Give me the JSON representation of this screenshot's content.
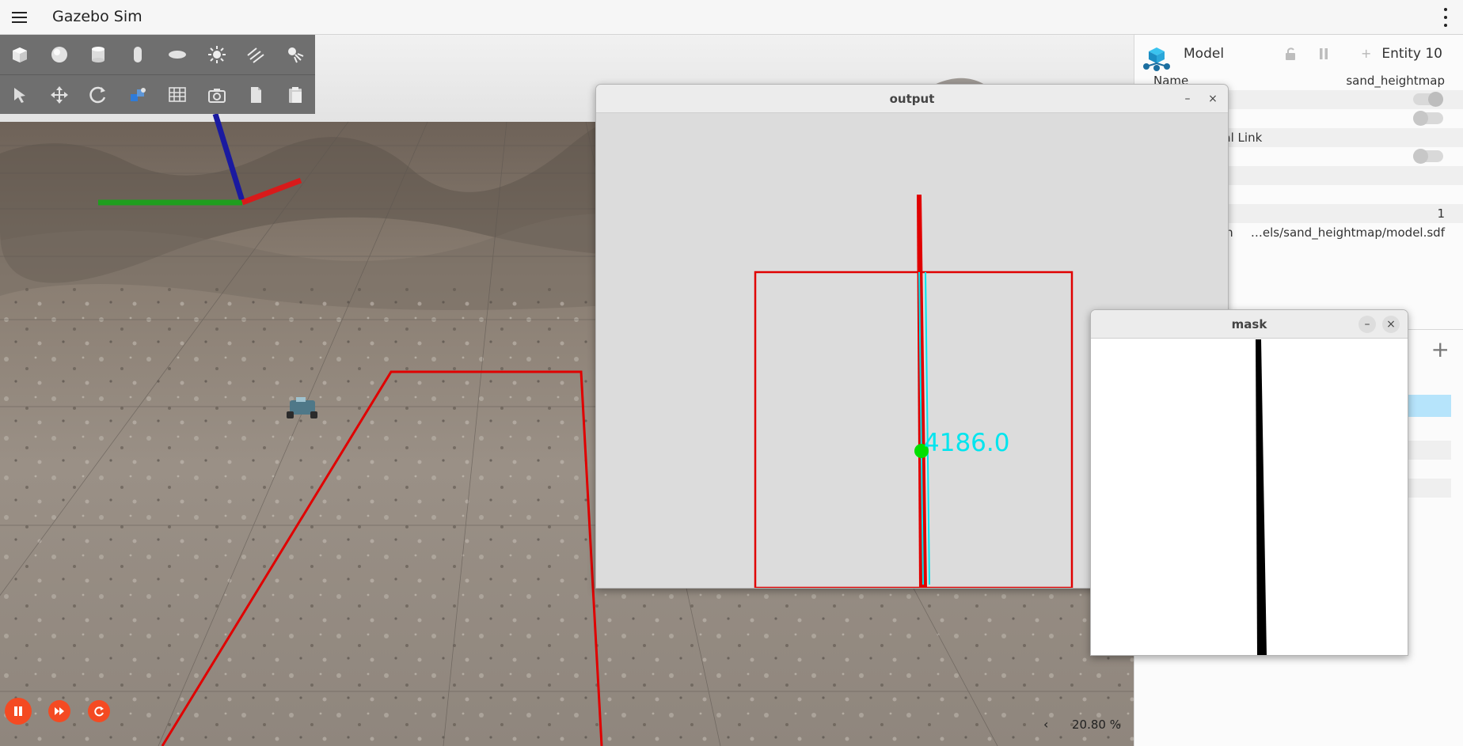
{
  "app": {
    "title": "Gazebo Sim"
  },
  "toolbar": {
    "row1": [
      "box-icon",
      "sphere-icon",
      "cylinder-icon",
      "capsule-icon",
      "ellipsoid-icon",
      "sun-icon",
      "directional-light-icon",
      "spot-light-icon"
    ],
    "row2": [
      "select-arrow-icon",
      "translate-icon",
      "rotate-icon",
      "transform-icon",
      "grid-icon",
      "camera-icon",
      "copy-icon",
      "paste-icon"
    ]
  },
  "component_inspector": {
    "title": "Model",
    "entity": "Entity 10",
    "name_label": "Name",
    "name_value": "sand_heightmap",
    "canonical_link_fragment": "ical Link",
    "count_value": "1",
    "path_label_fragment": "ath",
    "path_value": "…els/sand_heightmap/model.sdf"
  },
  "bottom_bar": {
    "zoom": "20.80 %",
    "collapse_label": "‹"
  },
  "output_window": {
    "title": "output",
    "measure_label": "4186.0",
    "minimize_label": "–",
    "close_label": "×"
  },
  "mask_window": {
    "title": "mask",
    "minimize_label": "–",
    "close_label": "×"
  },
  "colors": {
    "accent": "#f44a22",
    "overlay_red": "#e00000",
    "cyan": "#00e5ee",
    "green": "#00e000"
  }
}
